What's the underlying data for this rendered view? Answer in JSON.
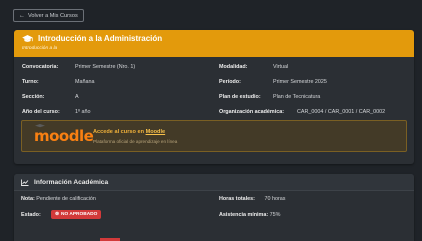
{
  "back_button": {
    "label": "Volver a Mis Cursos"
  },
  "course": {
    "title": "Introducción a la Administración",
    "subtitle": "Introducción a la",
    "details": [
      {
        "label": "Convocatoria:",
        "value": "Primer Semestre (Nro. 1)",
        "label2": "Modalidad:",
        "value2": "Virtual"
      },
      {
        "label": "Turno:",
        "value": "Mañana",
        "label2": "Período:",
        "value2": "Primer Semestre 2025"
      },
      {
        "label": "Sección:",
        "value": "A",
        "label2": "Plan de estudio:",
        "value2": "Plan de Tecnicatura"
      },
      {
        "label": "Año del curso:",
        "value": "1º año",
        "label2": "Organización académica:",
        "value2": "CAR_0004 / CAR_0001 / CAR_0002"
      }
    ],
    "accent_color": "#e39a0c"
  },
  "moodle": {
    "logo_text": "moodle",
    "access_prefix": "Accede al curso en",
    "access_link": "Moodle",
    "description": "Plataforma oficial de aprendizaje en línea"
  },
  "academic": {
    "title": "Información Académica",
    "note_label": "Nota:",
    "note_value": "Pendiente de calificación",
    "hours_label": "Horas totales:",
    "hours_value": "70 horas",
    "status_label": "Estado:",
    "status_value": "NO APROBADO",
    "status_color": "#d23a3a",
    "attendance_label": "Asistencia mínima:",
    "attendance_value": "75%"
  }
}
